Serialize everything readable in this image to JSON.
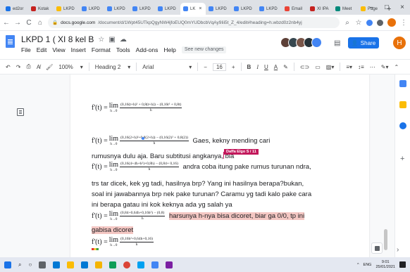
{
  "browser": {
    "tabs": [
      {
        "label": "ed2or",
        "color": "#1a73e8"
      },
      {
        "label": "Kotak",
        "color": "#c5221f"
      },
      {
        "label": "LKPD",
        "color": "#fbbc04"
      },
      {
        "label": "LKPD",
        "color": "#4285f4"
      },
      {
        "label": "LKPD",
        "color": "#4285f4"
      },
      {
        "label": "LKPD",
        "color": "#4285f4"
      },
      {
        "label": "LKPD",
        "color": "#4285f4"
      },
      {
        "label": "LK",
        "color": "#4285f4",
        "active": true
      },
      {
        "label": "LKPD",
        "color": "#4285f4"
      },
      {
        "label": "LKPD",
        "color": "#4285f4"
      },
      {
        "label": "LKPD",
        "color": "#4285f4"
      },
      {
        "label": "Email",
        "color": "#ea4335"
      },
      {
        "label": "XI IPA",
        "color": "#c5221f"
      },
      {
        "label": "Meet",
        "color": "#00897b"
      },
      {
        "label": "Page",
        "color": "#fbbc04"
      }
    ],
    "tab_close": "×",
    "new_tab": "+",
    "window_controls": {
      "minimize": "–",
      "maximize": "□",
      "close": "×"
    },
    "url_domain": "docs.google.com",
    "url_path": "/document/d/1Wpt45UTkpQgyNW4jfoEUQ0mYUDbcbVqAy9Iii5t_Z_4/edit#heading=h.wbzd0z2nb4yj"
  },
  "docs": {
    "title": "LKPD 1 ( XI 8 kel B",
    "menu": [
      "File",
      "Edit",
      "View",
      "Insert",
      "Format",
      "Tools",
      "Add-ons",
      "Help"
    ],
    "last_edit": "See new changes",
    "share_label": "Share",
    "user_initial": "H",
    "collaborator_colors": [
      "#5d4037",
      "#37474f",
      "#795548",
      "#263238",
      "#4285f4"
    ]
  },
  "toolbar": {
    "zoom": "100%",
    "style": "Heading 2",
    "font": "Arial",
    "font_size": "16",
    "bold": "B",
    "italic": "I",
    "underline": "U",
    "text_color": "A"
  },
  "content": {
    "f1_num": "(0,16(t+h)² + 0,8(t+h)) − (0,16t² + 0,8t)",
    "f2_num": "(0,16(2+h)²+0,8(2+h)) − (0,16(2)² + 0,8(2))",
    "f2_comment": "Gaes, kekny mending cari",
    "line3": "rumusnya dulu aja. Baru subtitusi angkanya, bia",
    "cursor_name": "Daffa Elgo S / 11",
    "f3_num": "(0,16(4+4h+h²)+0,8h) − (0,84+ 0,16)",
    "f3_comment": "andra coba itung pake rumus turunan ndra,",
    "line5": "trs tar dicek, kek yg tadi, hasilnya brp? Yang ini hasilnya berapa?bukan,",
    "line6": "soal ini jawabannya brp nek pake turunan? Caramu yg tadi kalo pake cara",
    "line7": "ini berapa gatau ini kok keknya ada yg salah ya",
    "f4_num": "(0,84+0,64h+0,16h²) − (0,8)",
    "f4_comment": "harsunya h-nya bisa dicoret, biar ga 0/0, tp ini",
    "line9": "gabisa dicoret",
    "f5_num": "(0,16h²+0,64h+0,16)",
    "fx": "f'(t) =",
    "lim": "lim",
    "lim_sub": "h→0",
    "den": "h"
  },
  "taskbar": {
    "lang": "ENG",
    "time": "9:01",
    "date": "25/01/2021",
    "up_arrow": "^"
  }
}
